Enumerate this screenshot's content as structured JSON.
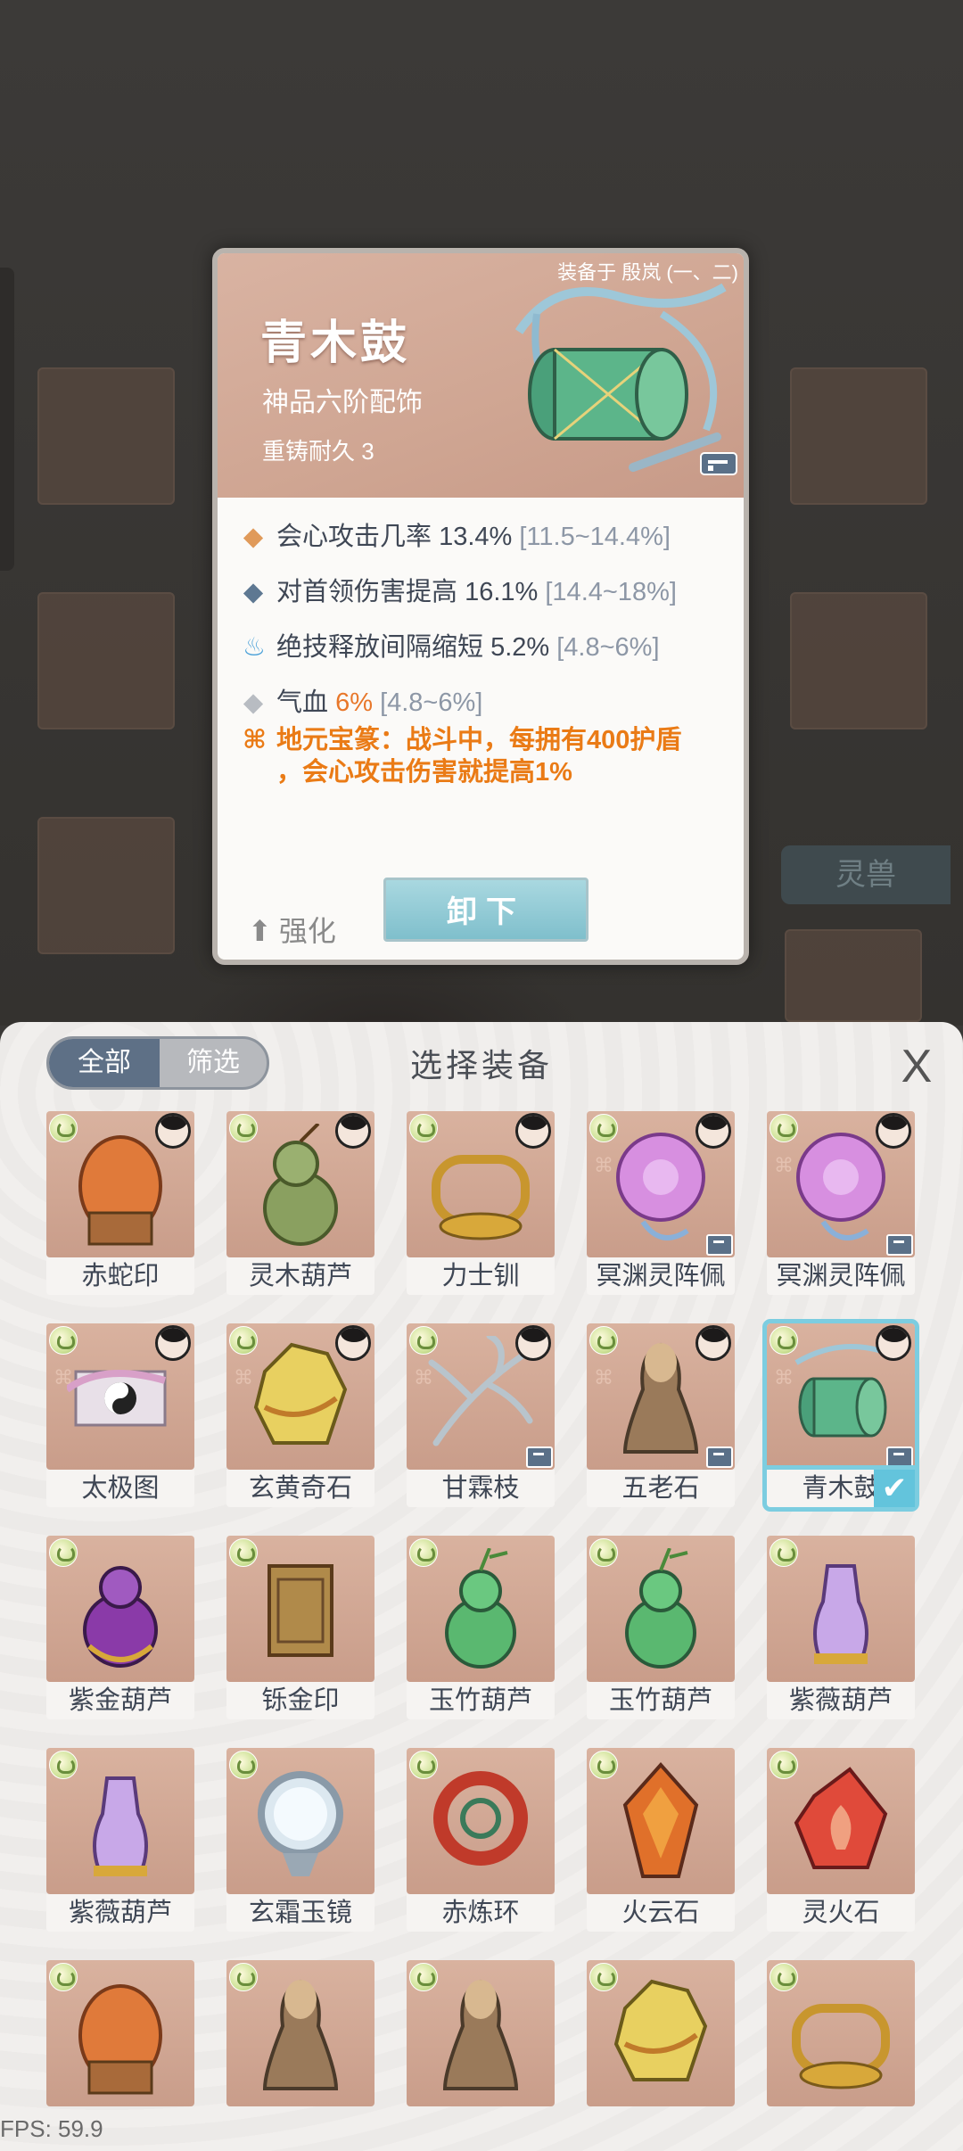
{
  "background": {
    "side_tab_label": "灵兽"
  },
  "detail": {
    "equipped_by": "装备于 殷岚 (一、二)",
    "name": "青木鼓",
    "grade": "神品六阶配饰",
    "durability": "重铸耐久 3",
    "stats": [
      {
        "icon": "diamond-orange-icon",
        "label": "会心攻击几率",
        "value": "13.4%",
        "range": "[11.5~14.4%]"
      },
      {
        "icon": "diamond-blue-icon",
        "label": "对首领伤害提高",
        "value": "16.1%",
        "range": "[14.4~18%]"
      },
      {
        "icon": "flame-blue-icon",
        "label": "绝技释放间隔缩短",
        "value": "5.2%",
        "range": "[4.8~6%]"
      },
      {
        "icon": "diamond-grey-icon",
        "label": "气血",
        "value": "6%",
        "range": "[4.8~6%]"
      }
    ],
    "special_line1": "地元宝篆：战斗中，每拥有400护盾",
    "special_line2": "，会心攻击伤害就提高1%",
    "enhance_label": "强化",
    "unequip_label": "卸下"
  },
  "panel": {
    "tab_all": "全部",
    "tab_filter": "筛选",
    "title": "选择装备",
    "close_label": "X"
  },
  "items": [
    {
      "name": "赤蛇印",
      "art": "red-seal",
      "avatar": true,
      "knot": false,
      "lock": false
    },
    {
      "name": "灵木葫芦",
      "art": "wood-gourd",
      "avatar": true,
      "knot": false,
      "lock": false
    },
    {
      "name": "力士钏",
      "art": "gold-bracelet",
      "avatar": true,
      "knot": false,
      "lock": false
    },
    {
      "name": "冥渊灵阵佩",
      "art": "purple-pendant",
      "avatar": true,
      "knot": true,
      "lock": true
    },
    {
      "name": "冥渊灵阵佩",
      "art": "purple-pendant",
      "avatar": true,
      "knot": true,
      "lock": true
    },
    {
      "name": "太极图",
      "art": "taiji-scroll",
      "avatar": true,
      "knot": true,
      "lock": false
    },
    {
      "name": "玄黄奇石",
      "art": "yellow-stone",
      "avatar": true,
      "knot": true,
      "lock": false
    },
    {
      "name": "甘霖枝",
      "art": "branch",
      "avatar": true,
      "knot": true,
      "lock": true
    },
    {
      "name": "五老石",
      "art": "brown-stone",
      "avatar": true,
      "knot": true,
      "lock": true
    },
    {
      "name": "青木鼓",
      "art": "green-drum",
      "avatar": true,
      "knot": true,
      "lock": true,
      "selected": true
    },
    {
      "name": "紫金葫芦",
      "art": "purple-gold-gourd",
      "avatar": false,
      "knot": false,
      "lock": false
    },
    {
      "name": "铄金印",
      "art": "gold-seal",
      "avatar": false,
      "knot": false,
      "lock": false
    },
    {
      "name": "玉竹葫芦",
      "art": "green-gourd",
      "avatar": false,
      "knot": false,
      "lock": false
    },
    {
      "name": "玉竹葫芦",
      "art": "green-gourd",
      "avatar": false,
      "knot": false,
      "lock": false
    },
    {
      "name": "紫薇葫芦",
      "art": "violet-gourd",
      "avatar": false,
      "knot": false,
      "lock": false
    },
    {
      "name": "紫薇葫芦",
      "art": "violet-gourd",
      "avatar": false,
      "knot": false,
      "lock": false
    },
    {
      "name": "玄霜玉镜",
      "art": "jade-mirror",
      "avatar": false,
      "knot": false,
      "lock": false
    },
    {
      "name": "赤炼环",
      "art": "red-ring",
      "avatar": false,
      "knot": false,
      "lock": false
    },
    {
      "name": "火云石",
      "art": "fire-stone",
      "avatar": false,
      "knot": false,
      "lock": false
    },
    {
      "name": "灵火石",
      "art": "spirit-fire-stone",
      "avatar": false,
      "knot": false,
      "lock": false
    },
    {
      "name": "",
      "art": "red-seal",
      "avatar": false,
      "knot": false,
      "lock": false
    },
    {
      "name": "",
      "art": "brown-stone",
      "avatar": false,
      "knot": false,
      "lock": false
    },
    {
      "name": "",
      "art": "brown-stone",
      "avatar": false,
      "knot": false,
      "lock": false
    },
    {
      "name": "",
      "art": "yellow-stone",
      "avatar": false,
      "knot": false,
      "lock": false
    },
    {
      "name": "",
      "art": "gold-bracelet",
      "avatar": false,
      "knot": false,
      "lock": false
    }
  ],
  "colors": {
    "accent_orange": "#e8772a",
    "selected_cyan": "#63c4dc",
    "card_bg": "#d4aa96"
  },
  "fps": "FPS: 59.9"
}
